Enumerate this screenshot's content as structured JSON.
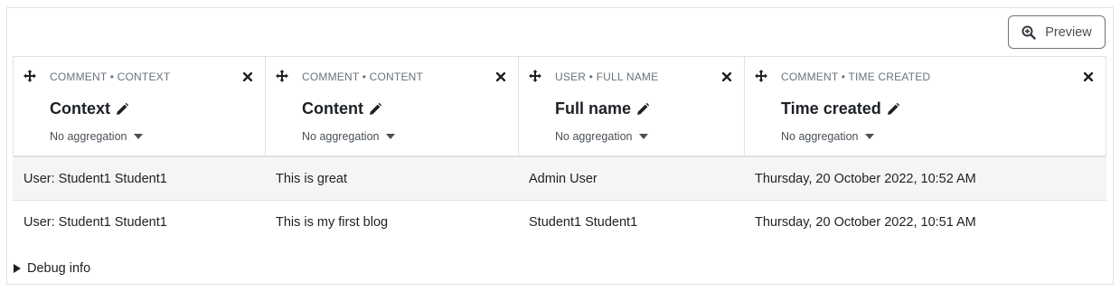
{
  "preview_button": {
    "label": "Preview",
    "icon": "zoom-in-icon"
  },
  "columns": [
    {
      "crumb": "COMMENT • CONTEXT",
      "title": "Context",
      "aggregation": "No aggregation"
    },
    {
      "crumb": "COMMENT • CONTENT",
      "title": "Content",
      "aggregation": "No aggregation"
    },
    {
      "crumb": "USER • FULL NAME",
      "title": "Full name",
      "aggregation": "No aggregation"
    },
    {
      "crumb": "COMMENT • TIME CREATED",
      "title": "Time created",
      "aggregation": "No aggregation"
    }
  ],
  "rows": [
    [
      "User: Student1 Student1",
      "This is great",
      "Admin User",
      "Thursday, 20 October 2022, 10:52 AM"
    ],
    [
      "User: Student1 Student1",
      "This is my first blog",
      "Student1 Student1",
      "Thursday, 20 October 2022, 10:51 AM"
    ]
  ],
  "debug": {
    "label": "Debug info"
  },
  "colors": {
    "border": "#dee2e6",
    "striped_row": "#f5f5f5",
    "muted_text": "#6a737b"
  }
}
